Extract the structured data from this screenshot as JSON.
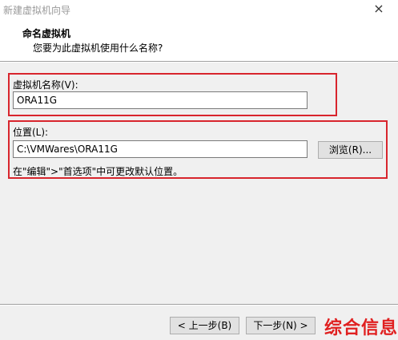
{
  "window": {
    "title": "新建虚拟机向导",
    "close_glyph": "×"
  },
  "header": {
    "title": "命名虚拟机",
    "subtitle": "您要为此虚拟机使用什么名称?"
  },
  "vm_name": {
    "label": "虚拟机名称(V):",
    "value": "ORA11G"
  },
  "location": {
    "label": "位置(L):",
    "value": "C:\\VMWares\\ORA11G",
    "browse_label": "浏览(R)...",
    "hint": "在\"编辑\">\"首选项\"中可更改默认位置。"
  },
  "footer": {
    "back_label": "< 上一步(B)",
    "next_label": "下一步(N) >"
  },
  "watermark": {
    "text": "综合信息"
  },
  "colors": {
    "highlight_border": "#d8252d",
    "watermark": "#e02020"
  }
}
